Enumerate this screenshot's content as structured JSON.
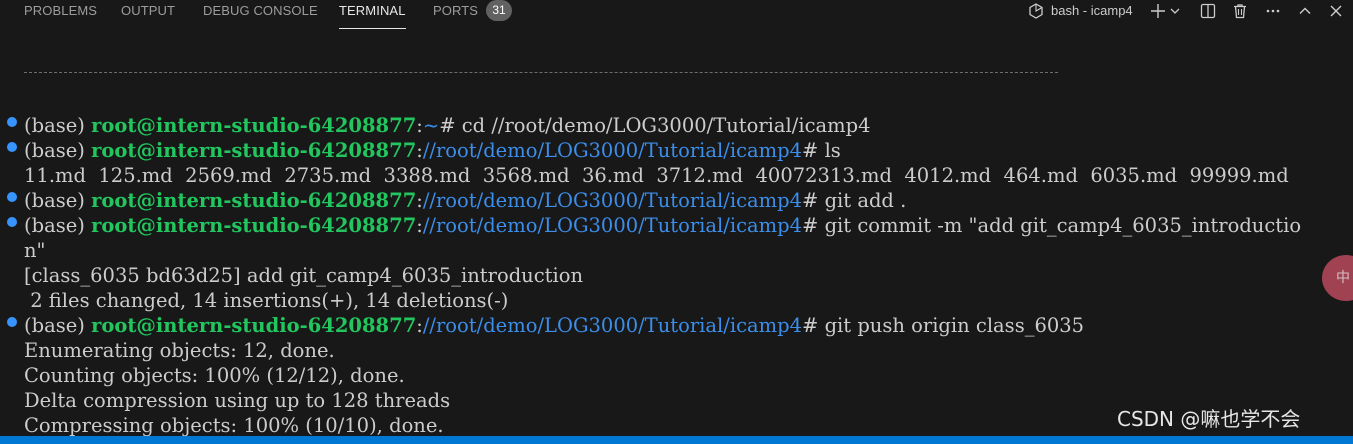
{
  "panel_tabs": [
    {
      "label": "PROBLEMS",
      "active": false
    },
    {
      "label": "OUTPUT",
      "active": false
    },
    {
      "label": "DEBUG CONSOLE",
      "active": false
    },
    {
      "label": "TERMINAL",
      "active": true
    },
    {
      "label": "PORTS",
      "active": false
    }
  ],
  "ports_badge": "31",
  "terminal_toolbar": {
    "shell_label": "bash - icamp4",
    "icons": [
      "terminal-icon",
      "plus-icon",
      "chevron-down-icon",
      "split-icon",
      "trash-icon",
      "more-icon",
      "chevron-up-icon",
      "close-icon"
    ]
  },
  "terminal_lines": [
    {
      "dot": true,
      "prompt_env": "(base) ",
      "user_host": "root@intern-studio-64208877",
      "sep": ":",
      "path": "~",
      "suffix": "# cd //root/demo/LOG3000/Tutorial/icamp4"
    },
    {
      "dot": true,
      "prompt_env": "(base) ",
      "user_host": "root@intern-studio-64208877",
      "sep": ":",
      "path": "//root/demo/LOG3000/Tutorial/icamp4",
      "suffix": "# ls"
    },
    {
      "dot": false,
      "text": "11.md  125.md  2569.md  2735.md  3388.md  3568.md  36.md  3712.md  40072313.md  4012.md  464.md  6035.md  99999.md"
    },
    {
      "dot": true,
      "prompt_env": "(base) ",
      "user_host": "root@intern-studio-64208877",
      "sep": ":",
      "path": "//root/demo/LOG3000/Tutorial/icamp4",
      "suffix": "# git add ."
    },
    {
      "dot": true,
      "prompt_env": "(base) ",
      "user_host": "root@intern-studio-64208877",
      "sep": ":",
      "path": "//root/demo/LOG3000/Tutorial/icamp4",
      "suffix": "# git commit -m \"add git_camp4_6035_introductio"
    },
    {
      "dot": false,
      "text": "n\""
    },
    {
      "dot": false,
      "text": "[class_6035 bd63d25] add git_camp4_6035_introduction"
    },
    {
      "dot": false,
      "text": " 2 files changed, 14 insertions(+), 14 deletions(-)"
    },
    {
      "dot": true,
      "prompt_env": "(base) ",
      "user_host": "root@intern-studio-64208877",
      "sep": ":",
      "path": "//root/demo/LOG3000/Tutorial/icamp4",
      "suffix": "# git push origin class_6035"
    },
    {
      "dot": false,
      "text": "Enumerating objects: 12, done."
    },
    {
      "dot": false,
      "text": "Counting objects: 100% (12/12), done."
    },
    {
      "dot": false,
      "text": "Delta compression using up to 128 threads"
    },
    {
      "dot": false,
      "text": "Compressing objects: 100% (10/10), done."
    }
  ],
  "side_bubble_text": "中",
  "watermark": "CSDN @嘛也学不会",
  "colors": {
    "background": "#181818",
    "prompt_green": "#22c55e",
    "path_blue": "#3b8eea",
    "dot_blue": "#3794ff",
    "status_bar": "#0078d4"
  }
}
